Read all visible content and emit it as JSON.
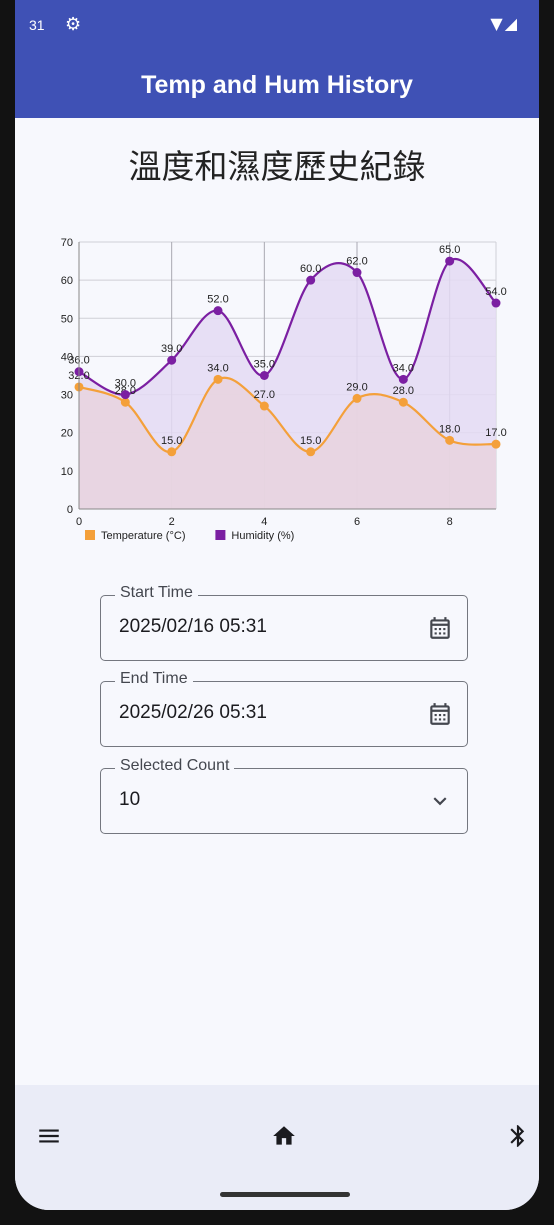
{
  "status": {
    "time": "31",
    "gear_icon": "gear-icon",
    "right_icons": "wifi-icon signal-icon"
  },
  "appbar": {
    "title": "Temp and Hum History"
  },
  "page": {
    "title": "溫度和濕度歷史紀錄"
  },
  "chart_data": {
    "type": "line",
    "x": [
      0,
      1,
      2,
      3,
      4,
      5,
      6,
      7,
      8,
      9
    ],
    "x_ticks": [
      "0",
      "2",
      "4",
      "6",
      "8"
    ],
    "y_ticks": [
      "0",
      "10",
      "20",
      "30",
      "40",
      "50",
      "60",
      "70"
    ],
    "ylim": [
      0,
      70
    ],
    "xlim": [
      0,
      9
    ],
    "grid": true,
    "legend_position": "bottom-left",
    "series": [
      {
        "name": "Temperature (°C)",
        "color": "#f4a03a",
        "fill": "#e8d3de",
        "values": [
          32.0,
          28.0,
          15.0,
          34.0,
          27.0,
          15.0,
          29.0,
          28.0,
          18.0,
          17.0
        ]
      },
      {
        "name": "Humidity (%)",
        "color": "#7b1fa2",
        "fill": "#e4daf3",
        "values": [
          36.0,
          30.0,
          39.0,
          52.0,
          35.0,
          60.0,
          62.0,
          34.0,
          65.0,
          54.0
        ]
      }
    ]
  },
  "form": {
    "start": {
      "label": "Start Time",
      "value": "2025/02/16 05:31",
      "icon": "calendar-icon"
    },
    "end": {
      "label": "End Time",
      "value": "2025/02/26 05:31",
      "icon": "calendar-icon"
    },
    "count": {
      "label": "Selected Count",
      "value": "10",
      "icon": "chevron-down-icon"
    }
  },
  "nav": {
    "left": "menu-icon",
    "center": "home-icon",
    "right": "bluetooth-icon"
  }
}
